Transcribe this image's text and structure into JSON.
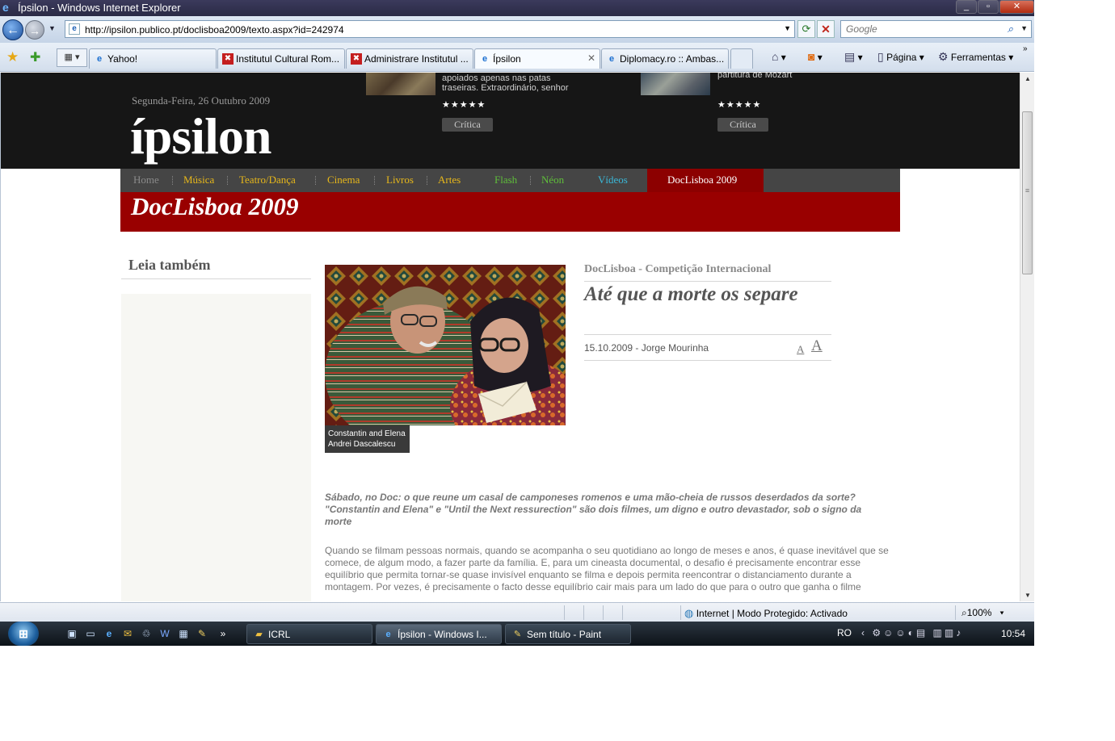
{
  "window": {
    "title": "Ípsilon - Windows Internet Explorer",
    "controls": [
      "_",
      "▫",
      "✕"
    ]
  },
  "navbar": {
    "url": "http://ipsilon.publico.pt/doclisboa2009/texto.aspx?id=242974",
    "search_placeholder": "Google"
  },
  "tabs": [
    {
      "label": "Yahoo!",
      "icon": "ie-page-icon"
    },
    {
      "label": "Institutul Cultural Rom...",
      "icon": "icr-logo-icon"
    },
    {
      "label": "Administrare Institutul ...",
      "icon": "icr-logo-icon"
    },
    {
      "label": "Ípsilon",
      "icon": "ie-page-icon",
      "active": true
    },
    {
      "label": "Diplomacy.ro :: Ambas...",
      "icon": "ie-page-icon"
    }
  ],
  "command_bar": {
    "page_label": "Página",
    "tools_label": "Ferramentas"
  },
  "site": {
    "date": "Segunda-Feira, 26 Outubro 2009",
    "logo": "ípsilon",
    "promos": [
      {
        "text": "apoiados apenas nas patas traseiras. Extraordinário, senhor",
        "stars": "★★★★★",
        "button": "Crítica"
      },
      {
        "text": "partitura de Mozart",
        "stars": "★★★★★",
        "button": "Crítica"
      }
    ],
    "menu": {
      "home": "Home",
      "items": [
        "Música",
        "Teatro/Dança",
        "Cinema",
        "Livros",
        "Artes"
      ],
      "flash": "Flash",
      "neon": "Néon",
      "videos": "Vídeos",
      "active": "DocLisboa 2009"
    },
    "section_title": "DocLisboa 2009"
  },
  "colors": {
    "masthead": "#161616",
    "menubar": "#454545",
    "banner": "#990000",
    "menu_active": "#8c0000",
    "menu_yellow": "#e8b81a",
    "menu_green": "#5fbf3a",
    "menu_cyan": "#3ab8d8"
  },
  "sidebar": {
    "heading": "Leia também"
  },
  "article": {
    "photo_caption_line1": "Constantin and Elena",
    "photo_caption_line2": "Andrei Dascalescu",
    "kicker": "DocLisboa - Competição Internacional",
    "headline": "Até que a morte os separe",
    "byline": "15.10.2009 - Jorge Mourinha",
    "font_small": "A",
    "font_large": "A",
    "lead": "Sábado, no Doc: o que reune um casal de camponeses romenos e uma mão-cheia de russos deserdados da sorte? \"Constantin and Elena\" e \"Until the Next ressurection\" são dois filmes, um digno e outro devastador, sob o signo da morte",
    "body": "Quando se filmam pessoas normais, quando se acompanha o seu quotidiano ao longo de meses e anos, é quase inevitável que se comece, de algum modo, a fazer parte da família. E, para um cineasta documental, o desafio é precisamente encontrar esse equilíbrio que permita tornar-se quase invisível enquanto se filma e depois permita reencontrar o distanciamento durante a montagem. Por vezes, é precisamente o facto desse equilíbrio cair mais para um lado do que para o outro que ganha o filme"
  },
  "statusbar": {
    "zone": "Internet | Modo Protegido: Activado",
    "zoom": "100%"
  },
  "taskbar": {
    "buttons": [
      {
        "label": "ICRL",
        "icon": "folder-icon"
      },
      {
        "label": "Ípsilon - Windows I...",
        "icon": "ie-icon",
        "active": true
      },
      {
        "label": "Sem título - Paint",
        "icon": "paint-icon"
      }
    ],
    "language": "RO",
    "time": "10:54"
  }
}
